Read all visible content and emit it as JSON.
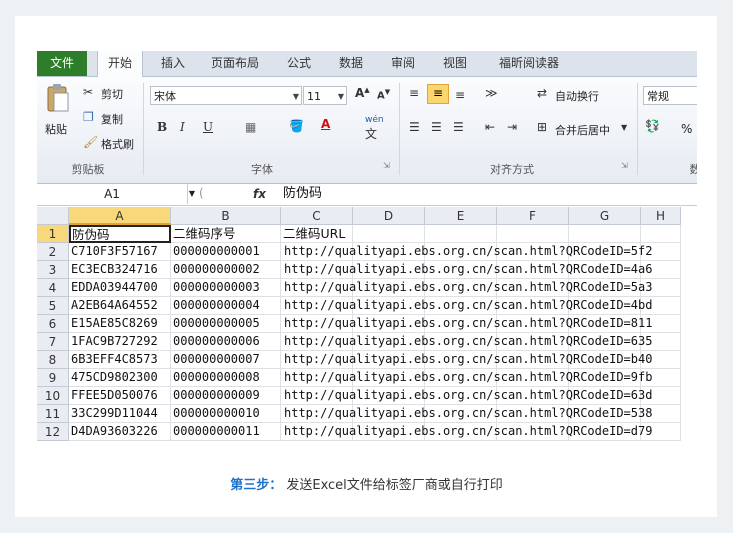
{
  "tabs": {
    "file": "文件",
    "home": "开始",
    "insert": "插入",
    "layout": "页面布局",
    "formula": "公式",
    "data": "数据",
    "review": "审阅",
    "view": "视图",
    "foxit": "福昕阅读器"
  },
  "ribbon": {
    "paste": "粘贴",
    "cut": "剪切",
    "copy": "复制",
    "format_painter": "格式刷",
    "clipboard": "剪贴板",
    "font_name": "宋体",
    "font_size": "11",
    "font_group": "字体",
    "wrap_text": "自动换行",
    "merge_center": "合并后居中",
    "alignment_group": "对齐方式",
    "number_format": "常规",
    "number_group": "数",
    "bold": "B",
    "italic": "I",
    "underline": "U",
    "wen": "wén",
    "wen_char": "文",
    "percent": "%"
  },
  "formula_bar": {
    "name_box": "A1",
    "fx": "fx",
    "value": "防伪码"
  },
  "columns": [
    "A",
    "B",
    "C",
    "D",
    "E",
    "F",
    "G",
    "H"
  ],
  "rows": [
    "1",
    "2",
    "3",
    "4",
    "5",
    "6",
    "7",
    "8",
    "9",
    "10",
    "11",
    "12"
  ],
  "headers": {
    "a": "防伪码",
    "b": "二维码序号",
    "c": "二维码URL"
  },
  "data": [
    {
      "code": "C710F3F57167",
      "seq": "000000000001",
      "url": "http://qualityapi.ebs.org.cn/scan.html?QRCodeID=5f2"
    },
    {
      "code": "EC3ECB324716",
      "seq": "000000000002",
      "url": "http://qualityapi.ebs.org.cn/scan.html?QRCodeID=4a6"
    },
    {
      "code": "EDDA03944700",
      "seq": "000000000003",
      "url": "http://qualityapi.ebs.org.cn/scan.html?QRCodeID=5a3"
    },
    {
      "code": "A2EB64A64552",
      "seq": "000000000004",
      "url": "http://qualityapi.ebs.org.cn/scan.html?QRCodeID=4bd"
    },
    {
      "code": "E15AE85C8269",
      "seq": "000000000005",
      "url": "http://qualityapi.ebs.org.cn/scan.html?QRCodeID=811"
    },
    {
      "code": "1FAC9B727292",
      "seq": "000000000006",
      "url": "http://qualityapi.ebs.org.cn/scan.html?QRCodeID=635"
    },
    {
      "code": "6B3EFF4C8573",
      "seq": "000000000007",
      "url": "http://qualityapi.ebs.org.cn/scan.html?QRCodeID=b40"
    },
    {
      "code": "475CD9802300",
      "seq": "000000000008",
      "url": "http://qualityapi.ebs.org.cn/scan.html?QRCodeID=9fb"
    },
    {
      "code": "FFEE5D050076",
      "seq": "000000000009",
      "url": "http://qualityapi.ebs.org.cn/scan.html?QRCodeID=63d"
    },
    {
      "code": "33C299D11044",
      "seq": "000000000010",
      "url": "http://qualityapi.ebs.org.cn/scan.html?QRCodeID=538"
    },
    {
      "code": "D4DA93603226",
      "seq": "000000000011",
      "url": "http://qualityapi.ebs.org.cn/scan.html?QRCodeID=d79"
    }
  ],
  "caption": {
    "step": "第三步：",
    "text": "发送Excel文件给标签厂商或自行打印"
  },
  "colors": {
    "file_tab": "#2d7d2a",
    "selection": "#f8d87a",
    "caption_step": "#1e73c9"
  }
}
